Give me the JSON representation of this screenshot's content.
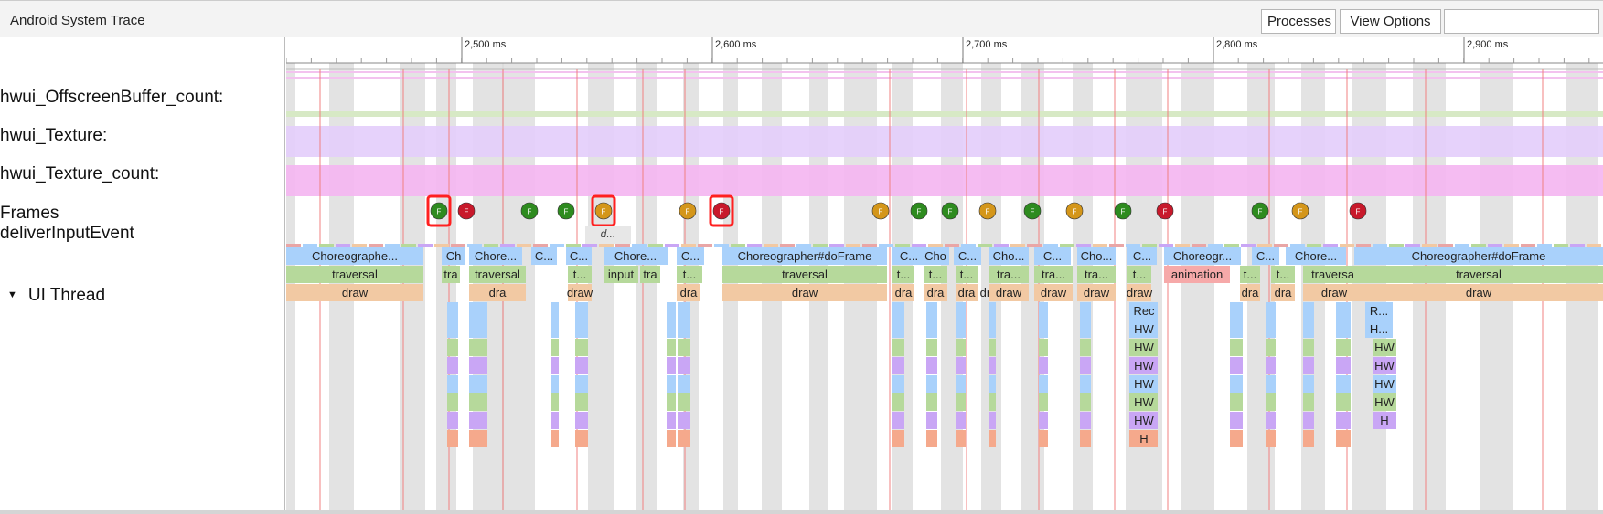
{
  "app": {
    "title": "Android System Trace",
    "processes_button": "Processes",
    "view_options_button": "View Options"
  },
  "ruler": {
    "labels": [
      "2,500 ms",
      "2,600 ms",
      "2,700 ms",
      "2,800 ms",
      "2,900 ms"
    ]
  },
  "tracks": {
    "offscreen_buffer": "hwui_OffscreenBuffer_count:",
    "texture": "hwui_Texture:",
    "texture_count": "hwui_Texture_count:",
    "frames": "Frames",
    "deliver_input": "deliverInputEvent",
    "ui_thread": "UI Thread"
  },
  "frames": {
    "markers": [
      {
        "letter": "F",
        "status": "green",
        "highlighted": true
      },
      {
        "letter": "F",
        "status": "red",
        "highlighted": false
      },
      {
        "letter": "F",
        "status": "green",
        "highlighted": false
      },
      {
        "letter": "F",
        "status": "green",
        "highlighted": false
      },
      {
        "letter": "F",
        "status": "orange",
        "highlighted": true
      },
      {
        "letter": "F",
        "status": "orange",
        "highlighted": false
      },
      {
        "letter": "F",
        "status": "red",
        "highlighted": true
      },
      {
        "letter": "F",
        "status": "orange",
        "highlighted": false
      },
      {
        "letter": "F",
        "status": "green",
        "highlighted": false
      },
      {
        "letter": "F",
        "status": "green",
        "highlighted": false
      },
      {
        "letter": "F",
        "status": "orange",
        "highlighted": false
      },
      {
        "letter": "F",
        "status": "green",
        "highlighted": false
      },
      {
        "letter": "F",
        "status": "orange",
        "highlighted": false
      },
      {
        "letter": "F",
        "status": "green",
        "highlighted": false
      },
      {
        "letter": "F",
        "status": "red",
        "highlighted": false
      },
      {
        "letter": "F",
        "status": "green",
        "highlighted": false
      },
      {
        "letter": "F",
        "status": "orange",
        "highlighted": false
      },
      {
        "letter": "F",
        "status": "red",
        "highlighted": false
      }
    ]
  },
  "deliver_input_slice": "d...",
  "slices": {
    "choreographer": [
      "Choreographe...",
      "Ch",
      "Chore...",
      "C...",
      "C...",
      "Chore...",
      "C...",
      "Choreographer#doFrame",
      "C...",
      "Cho",
      "C...",
      "Cho...",
      "C...",
      "Cho...",
      "C...",
      "Choreogr...",
      "C...",
      "Chore...",
      "Choreographer#doFrame"
    ],
    "traversal": [
      "traversal",
      "tra",
      "traversal",
      "t...",
      "input",
      "tra",
      "t...",
      "traversal",
      "t...",
      "t...",
      "t...",
      "tra...",
      "tra...",
      "tra...",
      "t...",
      "animation",
      "t...",
      "t...",
      "traversal",
      "traversal"
    ],
    "draw": [
      "draw",
      "dra",
      "draw",
      "dra",
      "dra",
      "draw",
      "dra",
      "dra",
      "dra",
      "draw",
      "draw",
      "draw",
      "draw",
      "dra",
      "dra",
      "draw",
      "draw"
    ],
    "render_deep": [
      "Rec",
      "HW",
      "HW",
      "HW",
      "HW",
      "HW",
      "HW",
      "H"
    ],
    "render_deep2": [
      "R...",
      "H...",
      "HW",
      "HW",
      "HW",
      "HW",
      "H"
    ]
  },
  "colors": {
    "frame_good": "#2e8b1f",
    "frame_janky": "#d4961a",
    "frame_bad": "#c8192b",
    "highlight_box": "#ff2020",
    "choreographer": "#a9d1fb",
    "traversal": "#b6d99b",
    "draw": "#f2c9a3",
    "animation": "#f6a9a9",
    "texture_band": "#e3cdfb",
    "texture_count_band": "#f4b5f1"
  }
}
